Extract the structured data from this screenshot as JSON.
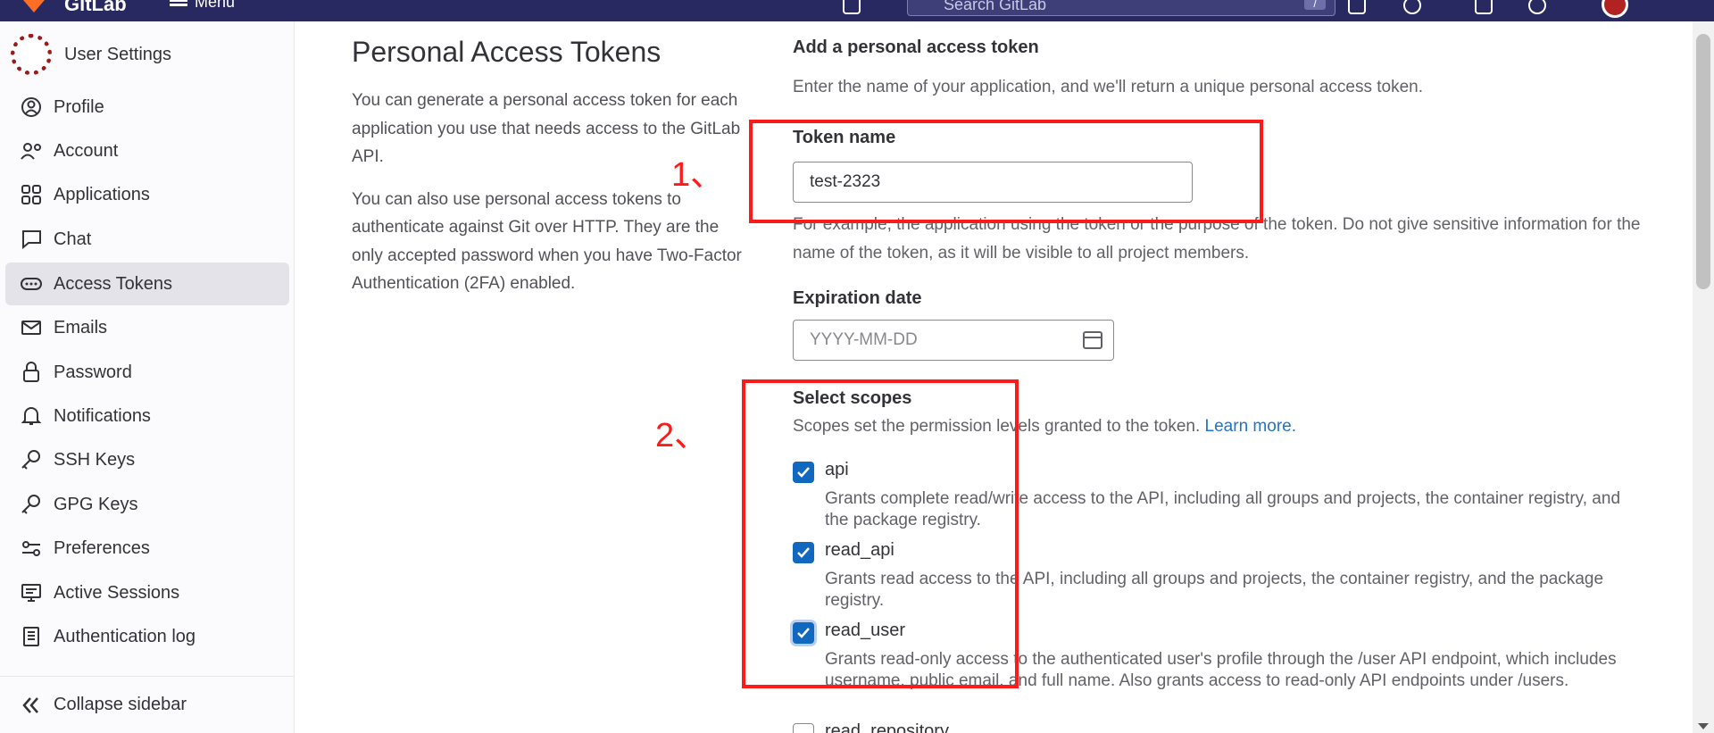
{
  "topbar": {
    "brand": "GitLab",
    "menu_label": "Menu",
    "search_placeholder": "Search GitLab",
    "search_shortcut": "/"
  },
  "sidebar": {
    "title": "User Settings",
    "items": [
      {
        "label": "Profile",
        "icon": "profile-icon"
      },
      {
        "label": "Account",
        "icon": "account-icon"
      },
      {
        "label": "Applications",
        "icon": "applications-icon"
      },
      {
        "label": "Chat",
        "icon": "chat-icon"
      },
      {
        "label": "Access Tokens",
        "icon": "access-tokens-icon",
        "active": true
      },
      {
        "label": "Emails",
        "icon": "emails-icon"
      },
      {
        "label": "Password",
        "icon": "lock-icon"
      },
      {
        "label": "Notifications",
        "icon": "bell-icon"
      },
      {
        "label": "SSH Keys",
        "icon": "key-icon"
      },
      {
        "label": "GPG Keys",
        "icon": "key-icon"
      },
      {
        "label": "Preferences",
        "icon": "preferences-icon"
      },
      {
        "label": "Active Sessions",
        "icon": "monitor-icon"
      },
      {
        "label": "Authentication log",
        "icon": "log-icon"
      }
    ],
    "collapse_label": "Collapse sidebar"
  },
  "page": {
    "title": "Personal Access Tokens",
    "para1": "You can generate a personal access token for each application you use that needs access to the GitLab API.",
    "para2": "You can also use personal access tokens to authenticate against Git over HTTP. They are the only accepted password when you have Two-Factor Authentication (2FA) enabled."
  },
  "form": {
    "heading": "Add a personal access token",
    "intro": "Enter the name of your application, and we'll return a unique personal access token.",
    "token_name_label": "Token name",
    "token_name_value": "test-2323",
    "token_name_help": "For example, the application using the token or the purpose of the token. Do not give sensitive information for the name of the token, as it will be visible to all project members.",
    "expiration_label": "Expiration date",
    "expiration_placeholder": "YYYY-MM-DD",
    "scopes_label": "Select scopes",
    "scopes_help": "Scopes set the permission levels granted to the token.",
    "learn_more": "Learn more.",
    "scopes": [
      {
        "name": "api",
        "checked": true,
        "desc": "Grants complete read/write access to the API, including all groups and projects, the container registry, and the package registry."
      },
      {
        "name": "read_api",
        "checked": true,
        "desc": "Grants read access to the API, including all groups and projects, the container registry, and the package registry."
      },
      {
        "name": "read_user",
        "checked": true,
        "desc": "Grants read-only access to the authenticated user's profile through the /user API endpoint, which includes username, public email, and full name. Also grants access to read-only API endpoints under /users."
      },
      {
        "name": "read_repository",
        "checked": false,
        "desc": ""
      }
    ]
  },
  "annotations": {
    "label1": "1、",
    "label2": "2、"
  },
  "colors": {
    "topbar": "#292961",
    "accent": "#1068bf",
    "annotation": "#ff1a1a"
  }
}
